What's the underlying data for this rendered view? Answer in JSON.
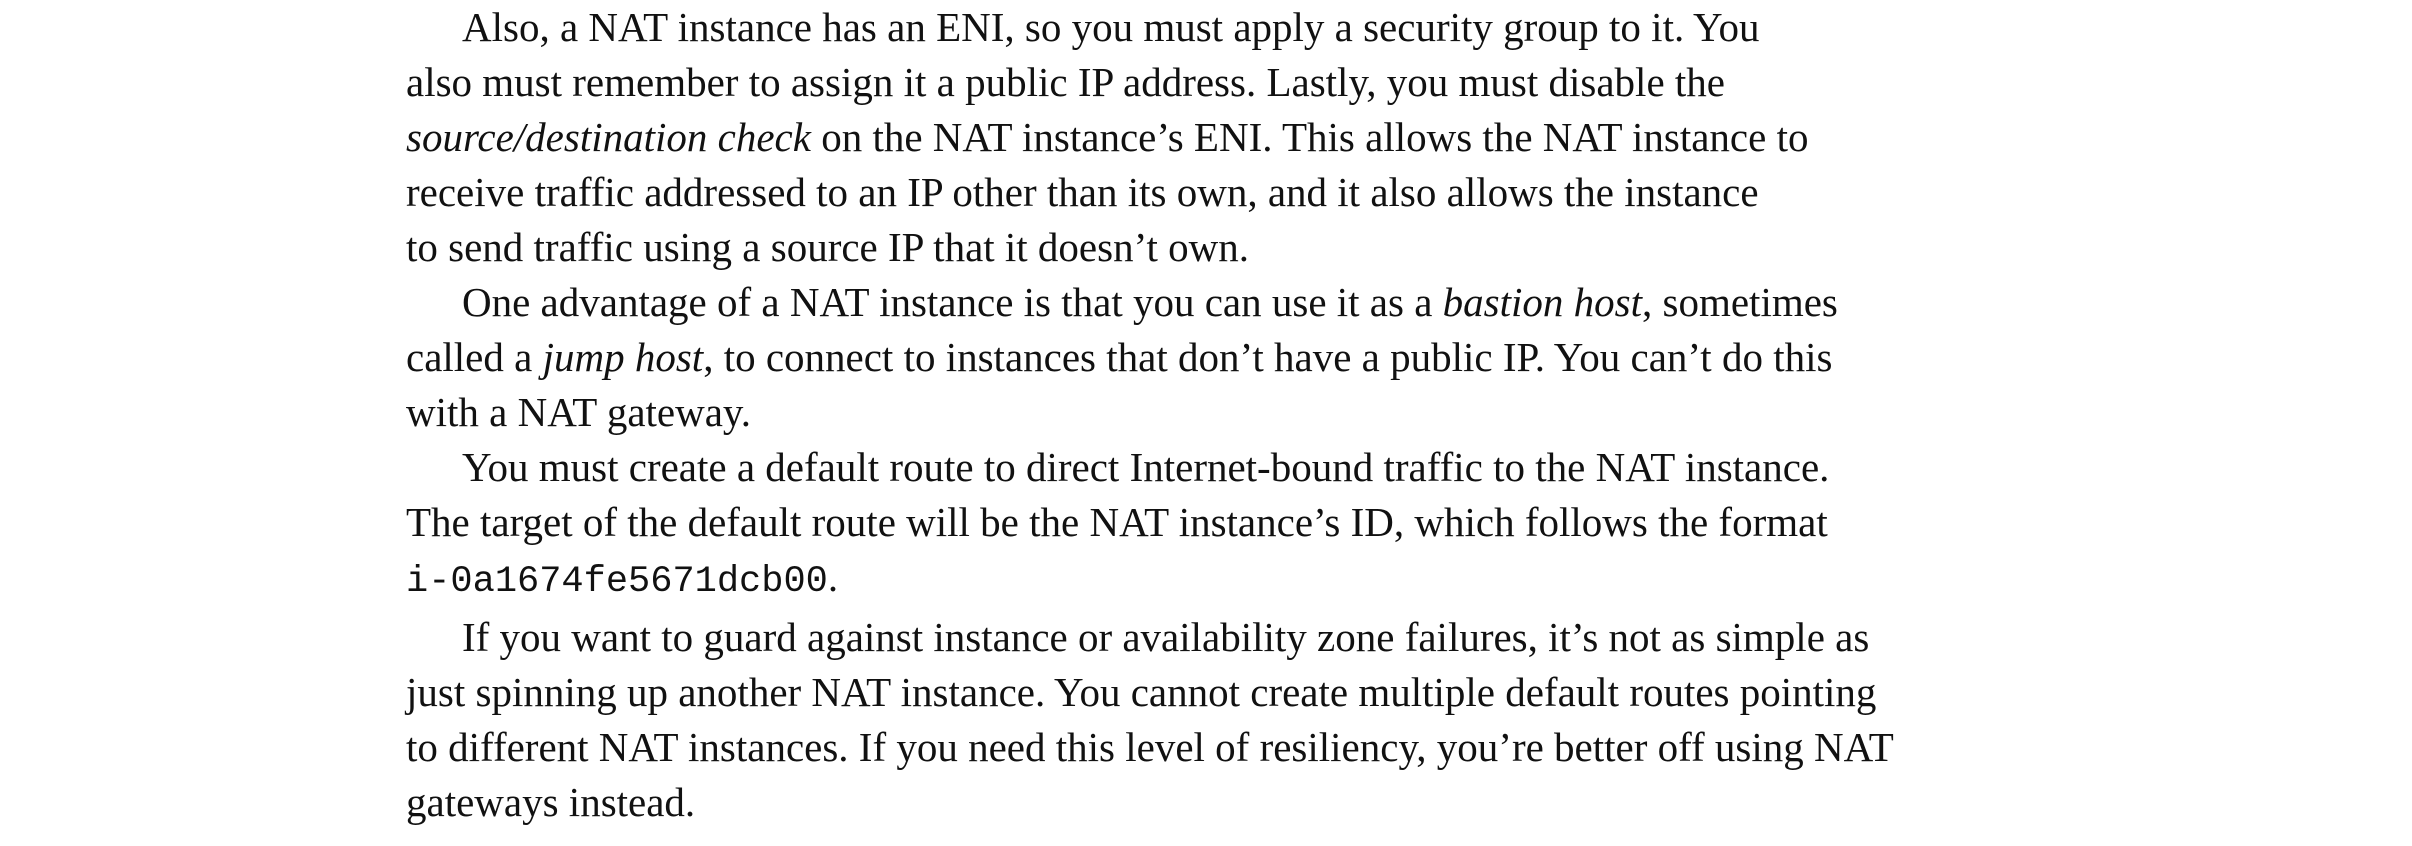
{
  "document": {
    "paragraphs": [
      {
        "lines": [
          {
            "segments": [
              {
                "text": "Also, a NAT instance has an ENI, so you must apply a security group to it. You"
              }
            ]
          },
          {
            "segments": [
              {
                "text": "also must remember to assign it a public IP address. Lastly, you must disable the"
              }
            ]
          },
          {
            "segments": [
              {
                "text": "source/destination check",
                "style": "italic"
              },
              {
                "text": " on the NAT instance’s ENI. This allows the NAT instance to"
              }
            ]
          },
          {
            "segments": [
              {
                "text": "receive traffic addressed to an IP other than its own, and it also allows the instance"
              }
            ]
          },
          {
            "segments": [
              {
                "text": "to send traffic using a source IP that it doesn’t own."
              }
            ]
          }
        ]
      },
      {
        "lines": [
          {
            "segments": [
              {
                "text": "One advantage of a NAT instance is that you can use it as a "
              },
              {
                "text": "bastion host",
                "style": "italic"
              },
              {
                "text": ", sometimes"
              }
            ]
          },
          {
            "segments": [
              {
                "text": "called a "
              },
              {
                "text": "jump host",
                "style": "italic"
              },
              {
                "text": ", to connect to instances that don’t have a public IP. You can’t do this"
              }
            ]
          },
          {
            "segments": [
              {
                "text": "with a NAT gateway."
              }
            ]
          }
        ]
      },
      {
        "lines": [
          {
            "segments": [
              {
                "text": "You must create a default route to direct Internet-bound traffic to the NAT instance."
              }
            ]
          },
          {
            "segments": [
              {
                "text": "The target of the default route will be the NAT instance’s ID, which follows the format"
              }
            ]
          },
          {
            "segments": [
              {
                "text": "i-0a1674fe5671dcb00",
                "style": "code"
              },
              {
                "text": "."
              }
            ]
          }
        ]
      },
      {
        "lines": [
          {
            "segments": [
              {
                "text": "If you want to guard against instance or availability zone failures, it’s not as simple as"
              }
            ]
          },
          {
            "segments": [
              {
                "text": "just spinning up another NAT instance. You cannot create multiple default routes pointing"
              }
            ]
          },
          {
            "segments": [
              {
                "text": "to different NAT instances. If you need this level of resiliency, you’re better off using NAT"
              }
            ]
          },
          {
            "segments": [
              {
                "text": "gateways instead."
              }
            ]
          }
        ]
      }
    ]
  }
}
